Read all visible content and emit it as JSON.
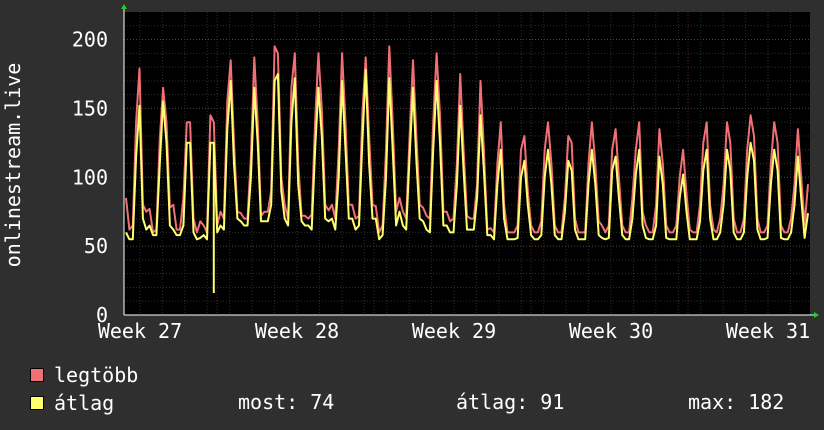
{
  "chart_data": {
    "type": "line",
    "ylabel": "onlinestream.live",
    "ylim": [
      0,
      220
    ],
    "y_ticks": [
      "0",
      "50",
      "100",
      "150",
      "200"
    ],
    "x_ticks": [
      "Week 27",
      "Week 28",
      "Week 29",
      "Week 30",
      "Week 31"
    ],
    "grid": true,
    "background_color": "#000000",
    "grid_color": "#4a4a4a",
    "week_grid_color": "#5a2020",
    "series": [
      {
        "name": "legtöbb",
        "color": "#f07076",
        "values": [
          85,
          62,
          65,
          140,
          179,
          80,
          75,
          77,
          60,
          62,
          128,
          165,
          140,
          78,
          80,
          62,
          62,
          85,
          140,
          140,
          70,
          60,
          68,
          65,
          60,
          145,
          140,
          65,
          75,
          70,
          155,
          185,
          125,
          75,
          74,
          70,
          70,
          115,
          187,
          140,
          72,
          75,
          75,
          90,
          195,
          190,
          100,
          80,
          70,
          165,
          190,
          110,
          72,
          72,
          70,
          73,
          140,
          190,
          150,
          80,
          76,
          80,
          70,
          120,
          190,
          140,
          80,
          80,
          70,
          72,
          145,
          187,
          130,
          80,
          79,
          60,
          65,
          120,
          195,
          140,
          75,
          85,
          75,
          70,
          130,
          185,
          130,
          80,
          78,
          72,
          70,
          140,
          190,
          145,
          75,
          75,
          68,
          70,
          110,
          175,
          120,
          72,
          70,
          70,
          95,
          170,
          120,
          62,
          63,
          60,
          110,
          140,
          80,
          60,
          60,
          60,
          65,
          120,
          130,
          90,
          65,
          60,
          60,
          68,
          120,
          140,
          110,
          65,
          60,
          60,
          85,
          130,
          125,
          70,
          60,
          60,
          60,
          110,
          140,
          110,
          68,
          65,
          60,
          65,
          120,
          135,
          100,
          65,
          60,
          60,
          85,
          120,
          140,
          75,
          65,
          60,
          60,
          80,
          135,
          110,
          65,
          60,
          60,
          65,
          100,
          120,
          88,
          62,
          60,
          60,
          80,
          125,
          140,
          80,
          62,
          60,
          70,
          95,
          140,
          125,
          70,
          60,
          60,
          70,
          120,
          145,
          130,
          70,
          60,
          60,
          65,
          110,
          140,
          125,
          65,
          60,
          60,
          70,
          95,
          135,
          100,
          65,
          95
        ]
      },
      {
        "name": "átlag",
        "color": "#ffff6e",
        "values": [
          60,
          55,
          55,
          115,
          152,
          70,
          62,
          65,
          58,
          58,
          110,
          155,
          125,
          65,
          62,
          58,
          58,
          65,
          125,
          125,
          60,
          55,
          56,
          58,
          55,
          125,
          125,
          60,
          65,
          62,
          135,
          170,
          110,
          70,
          68,
          65,
          65,
          100,
          165,
          125,
          68,
          68,
          68,
          80,
          170,
          175,
          90,
          70,
          65,
          140,
          172,
          95,
          68,
          65,
          65,
          62,
          120,
          165,
          130,
          70,
          68,
          70,
          62,
          100,
          170,
          120,
          70,
          70,
          62,
          65,
          125,
          178,
          110,
          70,
          70,
          55,
          58,
          100,
          172,
          120,
          65,
          75,
          65,
          62,
          115,
          165,
          112,
          70,
          68,
          62,
          60,
          120,
          170,
          125,
          65,
          65,
          60,
          60,
          95,
          152,
          105,
          62,
          62,
          62,
          85,
          145,
          105,
          58,
          58,
          55,
          95,
          120,
          70,
          55,
          55,
          55,
          56,
          100,
          112,
          80,
          58,
          55,
          55,
          58,
          100,
          120,
          95,
          58,
          55,
          55,
          75,
          112,
          105,
          62,
          55,
          55,
          55,
          95,
          120,
          95,
          58,
          56,
          55,
          56,
          105,
          115,
          85,
          58,
          55,
          55,
          70,
          102,
          120,
          65,
          56,
          55,
          55,
          65,
          115,
          95,
          56,
          55,
          55,
          55,
          85,
          102,
          75,
          55,
          55,
          55,
          68,
          105,
          120,
          70,
          55,
          55,
          60,
          80,
          120,
          105,
          60,
          55,
          55,
          60,
          100,
          125,
          112,
          62,
          55,
          55,
          56,
          95,
          120,
          105,
          56,
          55,
          55,
          60,
          80,
          115,
          85,
          56,
          74
        ]
      }
    ],
    "dip": {
      "index": 26,
      "value": 16
    }
  },
  "legend": [
    {
      "label": "legtöbb",
      "color": "#f07076"
    },
    {
      "label": "átlag",
      "color": "#ffff6e"
    }
  ],
  "stats": {
    "most": "most: 74",
    "atlag": "átlag: 91",
    "max": "max: 182"
  }
}
